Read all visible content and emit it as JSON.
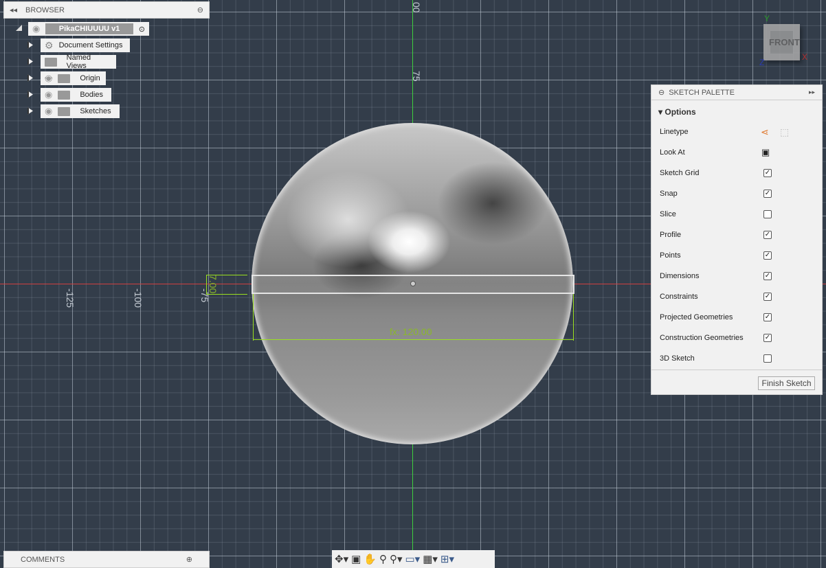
{
  "browser": {
    "title": "BROWSER",
    "root": "PikaCHIUUUU v1",
    "items": [
      {
        "label": "Document Settings",
        "icon": "gear-icon"
      },
      {
        "label": "Named Views",
        "icon": "folder-icon"
      },
      {
        "label": "Origin",
        "icon": "folder-icon",
        "visible": false
      },
      {
        "label": "Bodies",
        "icon": "folder-icon",
        "visible": true
      },
      {
        "label": "Sketches",
        "icon": "folder-icon",
        "visible": true
      }
    ]
  },
  "comments": {
    "title": "COMMENTS"
  },
  "rulers": {
    "top": "00",
    "v75": "75",
    "h_minus125": "-125",
    "h_minus100": "-100",
    "h_minus75": "-75"
  },
  "dimensions": {
    "height": "7.00",
    "width": "fx: 120.00"
  },
  "viewcube": {
    "face": "FRONT",
    "x": "X",
    "y": "Y",
    "z": "Z"
  },
  "palette": {
    "title": "SKETCH PALETTE",
    "section": "Options",
    "linetype": "Linetype",
    "look_at": "Look At",
    "options": [
      {
        "label": "Sketch Grid",
        "checked": true
      },
      {
        "label": "Snap",
        "checked": true
      },
      {
        "label": "Slice",
        "checked": false
      },
      {
        "label": "Profile",
        "checked": true
      },
      {
        "label": "Points",
        "checked": true
      },
      {
        "label": "Dimensions",
        "checked": true
      },
      {
        "label": "Constraints",
        "checked": true
      },
      {
        "label": "Projected Geometries",
        "checked": true
      },
      {
        "label": "Construction Geometries",
        "checked": true
      },
      {
        "label": "3D Sketch",
        "checked": false
      }
    ],
    "finish": "Finish Sketch"
  },
  "colors": {
    "background": "#333d4a",
    "x_axis": "#d04040",
    "y_axis": "#3ecf3e",
    "dimension": "#9be01f"
  }
}
